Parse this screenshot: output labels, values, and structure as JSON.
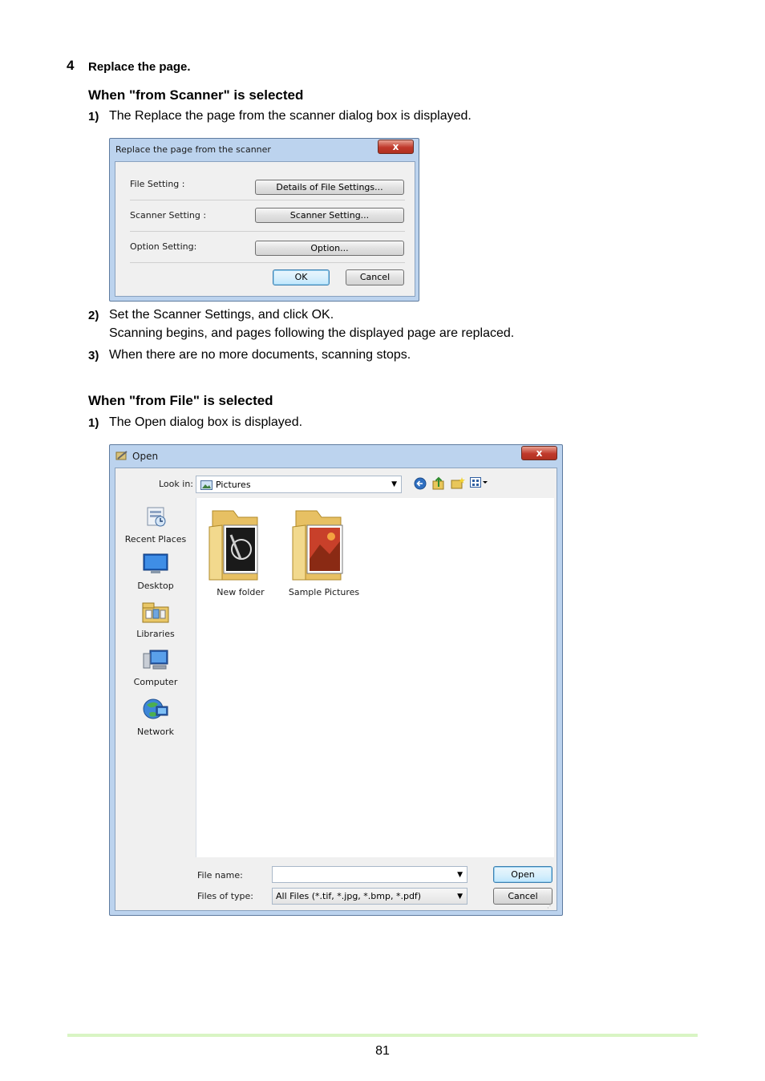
{
  "step": {
    "number": "4",
    "title": "Replace the page."
  },
  "section_scanner": {
    "heading": "When \"from Scanner\" is selected",
    "items": [
      {
        "num": "1)",
        "text": "The Replace the page from the scanner dialog box is displayed."
      },
      {
        "num": "2)",
        "text": "Set the Scanner Settings, and click OK.",
        "text2": "Scanning begins, and pages following the displayed page are replaced."
      },
      {
        "num": "3)",
        "text": "When there are no more documents, scanning stops."
      }
    ]
  },
  "scanner_dialog": {
    "title": "Replace the page from the scanner",
    "close": "x",
    "rows": [
      {
        "label": "File Setting :",
        "button": "Details of File Settings..."
      },
      {
        "label": "Scanner Setting :",
        "button": "Scanner Setting..."
      },
      {
        "label": "Option Setting:",
        "button": "Option..."
      }
    ],
    "ok": "OK",
    "cancel": "Cancel"
  },
  "section_file": {
    "heading": "When \"from File\" is selected",
    "items": [
      {
        "num": "1)",
        "text": "The Open dialog box is displayed."
      }
    ]
  },
  "open_dialog": {
    "title": "Open",
    "close": "x",
    "look_in_label": "Look in:",
    "look_in_value": "Pictures",
    "places": [
      {
        "label": "Recent Places",
        "icon": "recent-places-icon"
      },
      {
        "label": "Desktop",
        "icon": "desktop-icon"
      },
      {
        "label": "Libraries",
        "icon": "libraries-icon"
      },
      {
        "label": "Computer",
        "icon": "computer-icon"
      },
      {
        "label": "Network",
        "icon": "network-icon"
      }
    ],
    "files": [
      {
        "label": "New folder"
      },
      {
        "label": "Sample Pictures"
      }
    ],
    "file_name_label": "File name:",
    "file_name_value": "",
    "file_type_label": "Files of type:",
    "file_type_value": "All Files (*.tif, *.jpg, *.bmp, *.pdf)",
    "open_button": "Open",
    "cancel_button": "Cancel"
  },
  "page_number": "81"
}
